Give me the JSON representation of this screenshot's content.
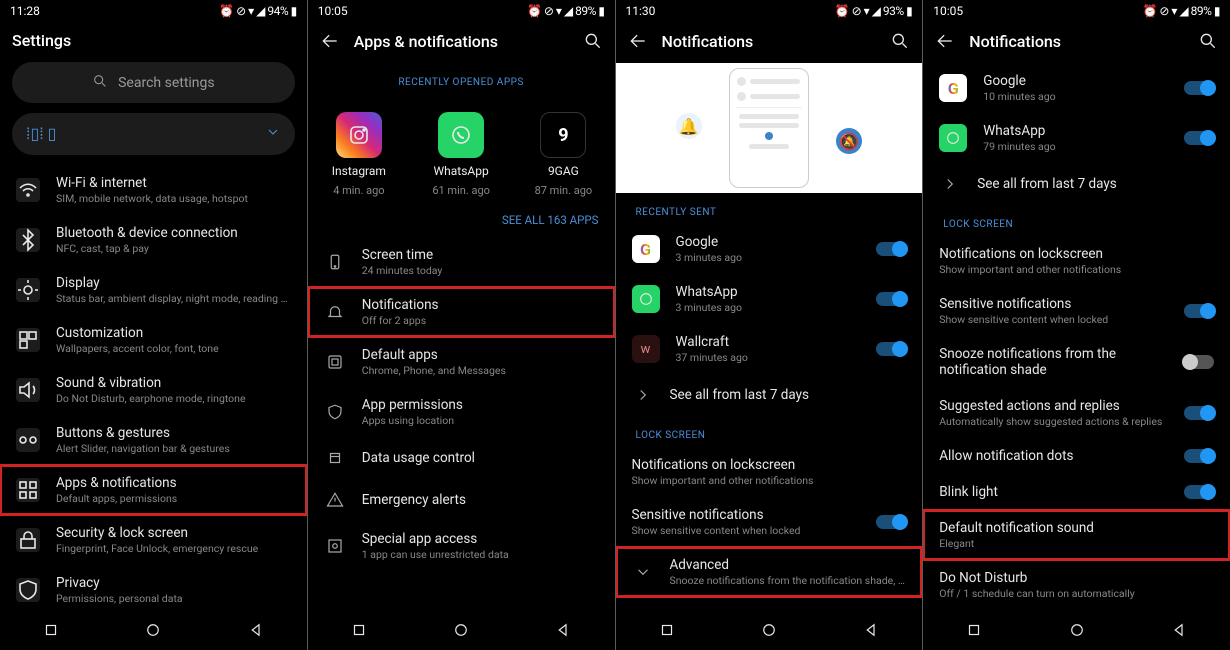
{
  "panels": [
    {
      "status": {
        "time": "11:28",
        "icons": "⏰ ⊘ ▾ ◢ 94% ▮"
      },
      "title": "Settings",
      "search_placeholder": "Search settings",
      "items": [
        {
          "label": "Wi-Fi & internet",
          "sub": "SIM, mobile network, data usage, hotspot"
        },
        {
          "label": "Bluetooth & device connection",
          "sub": "NFC, cast, tap & pay"
        },
        {
          "label": "Display",
          "sub": "Status bar, ambient display, night mode, reading mode"
        },
        {
          "label": "Customization",
          "sub": "Wallpapers, accent color, font, tone"
        },
        {
          "label": "Sound & vibration",
          "sub": "Do Not Disturb, earphone mode, ringtone"
        },
        {
          "label": "Buttons & gestures",
          "sub": "Alert Slider, navigation bar & gestures"
        },
        {
          "label": "Apps & notifications",
          "sub": "Default apps, permissions",
          "hl": true
        },
        {
          "label": "Security & lock screen",
          "sub": "Fingerprint, Face Unlock, emergency rescue"
        },
        {
          "label": "Privacy",
          "sub": "Permissions, personal data"
        }
      ]
    },
    {
      "status": {
        "time": "10:05",
        "icons": "⏰ ⊘ ▾ ◢ 89% ▮"
      },
      "title": "Apps & notifications",
      "recent_header": "RECENTLY OPENED APPS",
      "recent": [
        {
          "name": "Instagram",
          "sub": "4 min. ago"
        },
        {
          "name": "WhatsApp",
          "sub": "61 min. ago"
        },
        {
          "name": "9GAG",
          "sub": "87 min. ago"
        }
      ],
      "see_all_link": "SEE ALL 163 APPS",
      "items": [
        {
          "label": "Screen time",
          "sub": "24 minutes today"
        },
        {
          "label": "Notifications",
          "sub": "Off for 2 apps",
          "hl": true
        },
        {
          "label": "Default apps",
          "sub": "Chrome, Phone, and Messages"
        },
        {
          "label": "App permissions",
          "sub": "Apps using location"
        },
        {
          "label": "Data usage control",
          "sub": ""
        },
        {
          "label": "Emergency alerts",
          "sub": ""
        },
        {
          "label": "Special app access",
          "sub": "1 app can use unrestricted data"
        }
      ]
    },
    {
      "status": {
        "time": "11:30",
        "icons": "⏰ ⊘ ▾ ◢ 93% ▮"
      },
      "title": "Notifications",
      "section_recent": "RECENTLY SENT",
      "recent_noti": [
        {
          "name": "Google",
          "sub": "3 minutes ago",
          "on": true
        },
        {
          "name": "WhatsApp",
          "sub": "3 minutes ago",
          "on": true
        },
        {
          "name": "Wallcraft",
          "sub": "37 minutes ago",
          "on": true
        }
      ],
      "see_all": "See all from last 7 days",
      "section_lock": "LOCK SCREEN",
      "lock_items": [
        {
          "label": "Notifications on lockscreen",
          "sub": "Show important and other notifications"
        },
        {
          "label": "Sensitive notifications",
          "sub": "Show sensitive content when locked",
          "toggle": true
        }
      ],
      "advanced": {
        "label": "Advanced",
        "sub": "Snooze notifications from the notification shade, Suggested ac..."
      }
    },
    {
      "status": {
        "time": "10:05",
        "icons": "⏰ ⊘ ▾ ◢ 89% ▮"
      },
      "title": "Notifications",
      "recent_noti": [
        {
          "name": "Google",
          "sub": "10 minutes ago",
          "on": true
        },
        {
          "name": "WhatsApp",
          "sub": "79 minutes ago",
          "on": true
        }
      ],
      "see_all": "See all from last 7 days",
      "section_lock": "LOCK SCREEN",
      "items": [
        {
          "label": "Notifications on lockscreen",
          "sub": "Show important and other notifications"
        },
        {
          "label": "Sensitive notifications",
          "sub": "Show sensitive content when locked",
          "toggle": true,
          "on": true
        },
        {
          "label": "Snooze notifications from the notification shade",
          "sub": "",
          "toggle": true,
          "on": false
        },
        {
          "label": "Suggested actions and replies",
          "sub": "Automatically show suggested actions & replies",
          "toggle": true,
          "on": true
        },
        {
          "label": "Allow notification dots",
          "sub": "",
          "toggle": true,
          "on": true
        },
        {
          "label": "Blink light",
          "sub": "",
          "toggle": true,
          "on": true
        },
        {
          "label": "Default notification sound",
          "sub": "Elegant",
          "hl": true
        },
        {
          "label": "Do Not Disturb",
          "sub": "Off / 1 schedule can turn on automatically"
        }
      ]
    }
  ]
}
